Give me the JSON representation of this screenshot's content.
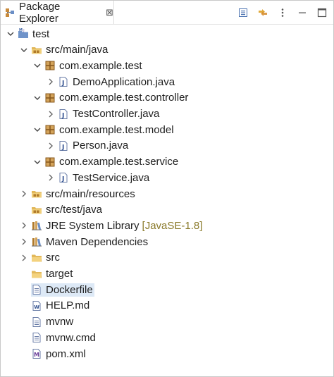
{
  "view": {
    "title": "Package Explorer",
    "close_glyph": "⊠"
  },
  "toolbar": {
    "icons": [
      "collapse-all-icon",
      "link-with-editor-icon",
      "view-menu-icon",
      "minimize-icon",
      "maximize-icon"
    ]
  },
  "tree": [
    {
      "label": "test",
      "icon": "project-icon",
      "expanded": true,
      "depth": 0
    },
    {
      "label": "src/main/java",
      "icon": "source-folder-icon",
      "expanded": true,
      "depth": 1
    },
    {
      "label": "com.example.test",
      "icon": "package-icon",
      "expanded": true,
      "depth": 2
    },
    {
      "label": "DemoApplication.java",
      "icon": "java-file-icon",
      "expanded": false,
      "depth": 3
    },
    {
      "label": "com.example.test.controller",
      "icon": "package-icon",
      "expanded": true,
      "depth": 2
    },
    {
      "label": "TestController.java",
      "icon": "java-file-icon",
      "expanded": false,
      "depth": 3
    },
    {
      "label": "com.example.test.model",
      "icon": "package-icon",
      "expanded": true,
      "depth": 2
    },
    {
      "label": "Person.java",
      "icon": "java-file-icon",
      "expanded": false,
      "depth": 3
    },
    {
      "label": "com.example.test.service",
      "icon": "package-icon",
      "expanded": true,
      "depth": 2
    },
    {
      "label": "TestService.java",
      "icon": "java-file-icon",
      "expanded": false,
      "depth": 3
    },
    {
      "label": "src/main/resources",
      "icon": "source-folder-icon",
      "expanded": false,
      "depth": 1
    },
    {
      "label": "src/test/java",
      "icon": "source-folder-icon",
      "expanded": null,
      "depth": 1
    },
    {
      "label": "JRE System Library",
      "decoration": "[JavaSE-1.8]",
      "icon": "library-icon",
      "expanded": false,
      "depth": 1
    },
    {
      "label": "Maven Dependencies",
      "icon": "library-icon",
      "expanded": false,
      "depth": 1
    },
    {
      "label": "src",
      "icon": "folder-icon",
      "expanded": false,
      "depth": 1
    },
    {
      "label": "target",
      "icon": "folder-icon",
      "expanded": null,
      "depth": 1
    },
    {
      "label": "Dockerfile",
      "icon": "text-file-icon",
      "expanded": null,
      "depth": 1,
      "selected": true
    },
    {
      "label": "HELP.md",
      "icon": "markdown-file-icon",
      "expanded": null,
      "depth": 1
    },
    {
      "label": "mvnw",
      "icon": "text-file-icon",
      "expanded": null,
      "depth": 1
    },
    {
      "label": "mvnw.cmd",
      "icon": "text-file-icon",
      "expanded": null,
      "depth": 1
    },
    {
      "label": "pom.xml",
      "icon": "maven-pom-icon",
      "expanded": null,
      "depth": 1
    }
  ]
}
